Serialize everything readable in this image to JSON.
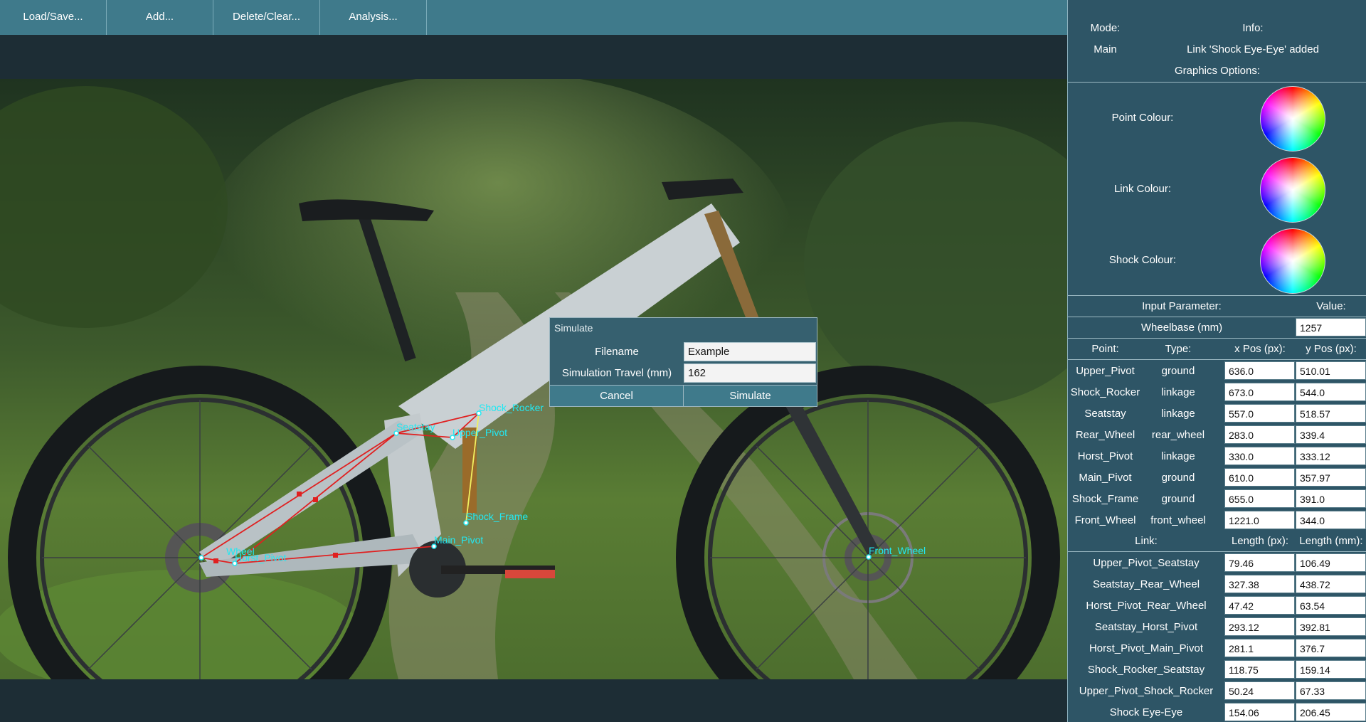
{
  "menu": {
    "load_save": "Load/Save...",
    "add": "Add...",
    "delete_clear": "Delete/Clear...",
    "analysis": "Analysis..."
  },
  "canvas": {
    "point_labels": {
      "shock_rocker": "Shock_Rocker",
      "seatstay": "Seatstay",
      "upper_pivot": "Upper_Pivot",
      "shock_frame": "Shock_Frame",
      "main_pivot": "Main_Pivot",
      "rear_wheel": "Wheel",
      "horst_pivot": "Horst_Pivot",
      "front_wheel": "Front_Wheel"
    },
    "colors": {
      "point": "#22e8f2",
      "link": "#e02020",
      "shock": "#f0f060"
    }
  },
  "dialog": {
    "title": "Simulate",
    "filename_label": "Filename",
    "filename_value": "Example",
    "travel_label": "Simulation Travel (mm)",
    "travel_value": "162",
    "cancel": "Cancel",
    "simulate": "Simulate"
  },
  "panel": {
    "mode_label": "Mode:",
    "info_label": "Info:",
    "mode_value": "Main",
    "info_value": "Link 'Shock Eye-Eye' added",
    "graphics_options": "Graphics Options:",
    "point_colour": "Point Colour:",
    "link_colour": "Link Colour:",
    "shock_colour": "Shock Colour:",
    "input_parameter": "Input Parameter:",
    "value_label": "Value:",
    "wheelbase_label": "Wheelbase (mm)",
    "wheelbase_value": "1257",
    "points_headers": {
      "point": "Point:",
      "type": "Type:",
      "x": "x Pos (px):",
      "y": "y Pos (px):"
    },
    "points": [
      {
        "name": "Upper_Pivot",
        "type": "ground",
        "x": "636.0",
        "y": "510.01"
      },
      {
        "name": "Shock_Rocker",
        "type": "linkage",
        "x": "673.0",
        "y": "544.0"
      },
      {
        "name": "Seatstay",
        "type": "linkage",
        "x": "557.0",
        "y": "518.57"
      },
      {
        "name": "Rear_Wheel",
        "type": "rear_wheel",
        "x": "283.0",
        "y": "339.4"
      },
      {
        "name": "Horst_Pivot",
        "type": "linkage",
        "x": "330.0",
        "y": "333.12"
      },
      {
        "name": "Main_Pivot",
        "type": "ground",
        "x": "610.0",
        "y": "357.97"
      },
      {
        "name": "Shock_Frame",
        "type": "ground",
        "x": "655.0",
        "y": "391.0"
      },
      {
        "name": "Front_Wheel",
        "type": "front_wheel",
        "x": "1221.0",
        "y": "344.0"
      }
    ],
    "links_headers": {
      "link": "Link:",
      "px": "Length (px):",
      "mm": "Length (mm):"
    },
    "links": [
      {
        "name": "Upper_Pivot_Seatstay",
        "px": "79.46",
        "mm": "106.49"
      },
      {
        "name": "Seatstay_Rear_Wheel",
        "px": "327.38",
        "mm": "438.72"
      },
      {
        "name": "Horst_Pivot_Rear_Wheel",
        "px": "47.42",
        "mm": "63.54"
      },
      {
        "name": "Seatstay_Horst_Pivot",
        "px": "293.12",
        "mm": "392.81"
      },
      {
        "name": "Horst_Pivot_Main_Pivot",
        "px": "281.1",
        "mm": "376.7"
      },
      {
        "name": "Shock_Rocker_Seatstay",
        "px": "118.75",
        "mm": "159.14"
      },
      {
        "name": "Upper_Pivot_Shock_Rocker",
        "px": "50.24",
        "mm": "67.33"
      },
      {
        "name": "Shock Eye-Eye",
        "px": "154.06",
        "mm": "206.45"
      }
    ]
  }
}
